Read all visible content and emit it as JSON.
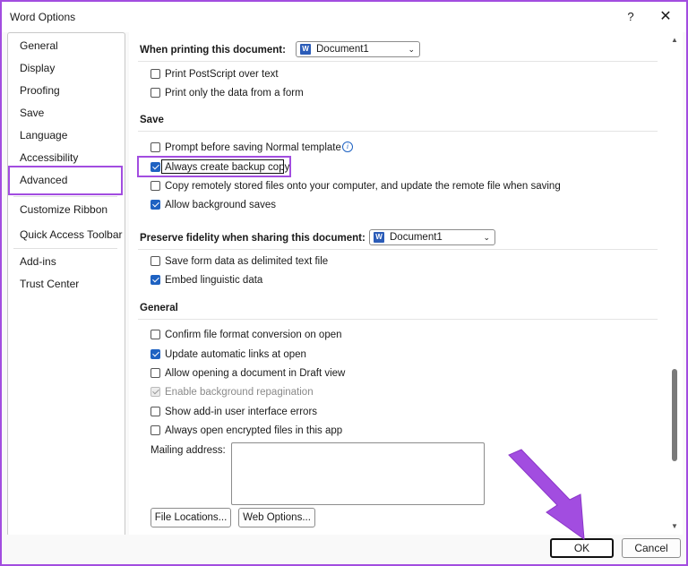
{
  "window": {
    "title": "Word Options",
    "help_label": "?",
    "close_label": "✕"
  },
  "nav": {
    "items": [
      {
        "label": "General"
      },
      {
        "label": "Display"
      },
      {
        "label": "Proofing"
      },
      {
        "label": "Save"
      },
      {
        "label": "Language"
      },
      {
        "label": "Accessibility"
      },
      {
        "label": "Advanced"
      },
      {
        "label": "Customize Ribbon"
      },
      {
        "label": "Quick Access Toolbar"
      },
      {
        "label": "Add-ins"
      },
      {
        "label": "Trust Center"
      }
    ],
    "selected": "Advanced"
  },
  "printing": {
    "heading": "When printing this document:",
    "document_value": "Document1",
    "options": [
      {
        "label": "Print PostScript over text",
        "checked": false
      },
      {
        "label": "Print only the data from a form",
        "checked": false
      }
    ]
  },
  "save": {
    "heading": "Save",
    "options": [
      {
        "label": "Prompt before saving Normal template",
        "checked": false
      },
      {
        "label": "Always create backup copy",
        "checked": true
      },
      {
        "label": "Copy remotely stored files onto your computer, and update the remote file when saving",
        "checked": false
      },
      {
        "label": "Allow background saves",
        "checked": true
      }
    ]
  },
  "fidelity": {
    "heading": "Preserve fidelity when sharing this document:",
    "document_value": "Document1",
    "options": [
      {
        "label": "Save form data as delimited text file",
        "checked": false
      },
      {
        "label": "Embed linguistic data",
        "checked": true
      }
    ]
  },
  "general": {
    "heading": "General",
    "options": [
      {
        "label": "Confirm file format conversion on open",
        "checked": false
      },
      {
        "label": "Update automatic links at open",
        "checked": true
      },
      {
        "label": "Allow opening a document in Draft view",
        "checked": false
      },
      {
        "label": "Enable background repagination",
        "checked": true,
        "disabled": true
      },
      {
        "label": "Show add-in user interface errors",
        "checked": false
      },
      {
        "label": "Always open encrypted files in this app",
        "checked": false
      }
    ],
    "mailing_label": "Mailing address:",
    "mailing_value": "",
    "file_locations_label": "File Locations...",
    "web_options_label": "Web Options..."
  },
  "footer": {
    "ok_label": "OK",
    "cancel_label": "Cancel"
  },
  "colors": {
    "highlight": "#a24de0",
    "checkbox_checked": "#1e62c2"
  }
}
